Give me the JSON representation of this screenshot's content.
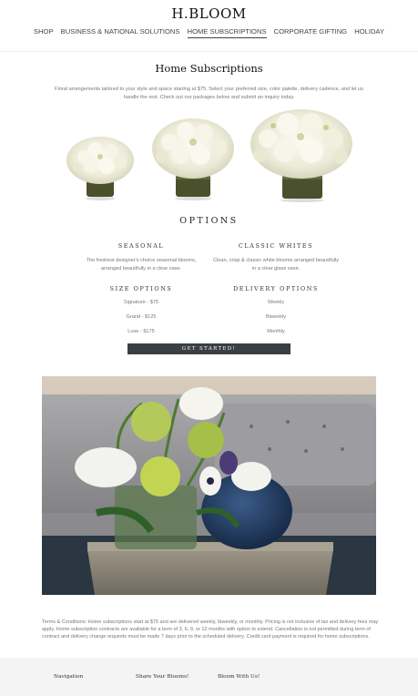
{
  "header": {
    "logo": "H.BLOOM",
    "nav": [
      {
        "label": "SHOP"
      },
      {
        "label": "BUSINESS & NATIONAL SOLUTIONS"
      },
      {
        "label": "HOME SUBSCRIPTIONS",
        "active": true
      },
      {
        "label": "CORPORATE GIFTING"
      },
      {
        "label": "HOLIDAY"
      }
    ]
  },
  "main": {
    "title": "Home Subscriptions",
    "intro": "Floral arrangements tailored to your style and space starting at $75. Select your preferred size, color palette, delivery cadence, and let us handle the rest. Check out our packages below and submit an inquiry today."
  },
  "options": {
    "title": "OPTIONS",
    "seasonal": {
      "heading": "SEASONAL",
      "description": "The freshest designer's choice seasonal blooms, arranged beautifully in a clear vase."
    },
    "classic": {
      "heading": "CLASSIC WHITES",
      "description": "Clean, crisp & classic white blooms arranged beautifully in a clear glass vase."
    },
    "size": {
      "heading": "SIZE OPTIONS",
      "items": [
        "Signature - $75",
        "Grand - $125",
        "Luxe - $175"
      ]
    },
    "delivery": {
      "heading": "DELIVERY OPTIONS",
      "items": [
        "Weekly",
        "Biweekly",
        "Monthly"
      ]
    },
    "cta_label": "GET STARTED!"
  },
  "terms": "Terms & Conditions: Home subscriptions start at $75 and are delivered weekly, biweekly, or monthly. Pricing is not inclusive of tax and delivery fees may apply. Home subscription contracts are available for a term of 3, 6, 9, or 12 months with option to extend. Cancellation is not permitted during term of contract and delivery change requests must be made 7 days prior to the scheduled delivery. Credit card payment is required for home subscriptions.",
  "footer": {
    "navigation": "Navigation",
    "share": "Share Your Blooms!",
    "bloom": "Bloom With Us!"
  },
  "colors": {
    "button_bg": "#3c3f42",
    "footer_bg": "#f4f4f4",
    "text_muted": "#777777"
  }
}
